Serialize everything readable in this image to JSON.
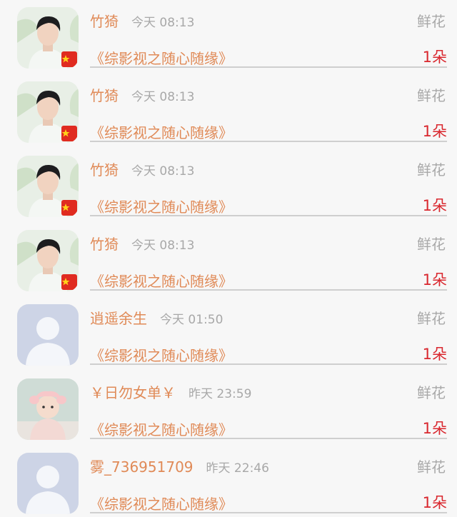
{
  "rows": [
    {
      "name": "竹猗",
      "time": "今天 08:13",
      "gift": "鲜花",
      "book": "《综影视之随心随缘》",
      "amount": "1朵",
      "avatar": "man-flag-icon"
    },
    {
      "name": "竹猗",
      "time": "今天 08:13",
      "gift": "鲜花",
      "book": "《综影视之随心随缘》",
      "amount": "1朵",
      "avatar": "man-flag-icon"
    },
    {
      "name": "竹猗",
      "time": "今天 08:13",
      "gift": "鲜花",
      "book": "《综影视之随心随缘》",
      "amount": "1朵",
      "avatar": "man-flag-icon"
    },
    {
      "name": "竹猗",
      "time": "今天 08:13",
      "gift": "鲜花",
      "book": "《综影视之随心随缘》",
      "amount": "1朵",
      "avatar": "man-flag-icon"
    },
    {
      "name": "逍遥余生",
      "time": "今天 01:50",
      "gift": "鲜花",
      "book": "《综影视之随心随缘》",
      "amount": "1朵",
      "avatar": "default-user-icon"
    },
    {
      "name": "￥日勿女单￥",
      "time": "昨天 23:59",
      "gift": "鲜花",
      "book": "《综影视之随心随缘》",
      "amount": "1朵",
      "avatar": "baby-photo-icon"
    },
    {
      "name": "雾_736951709",
      "time": "昨天 22:46",
      "gift": "鲜花",
      "book": "《综影视之随心随缘》",
      "amount": "1朵",
      "avatar": "default-user-icon"
    }
  ]
}
